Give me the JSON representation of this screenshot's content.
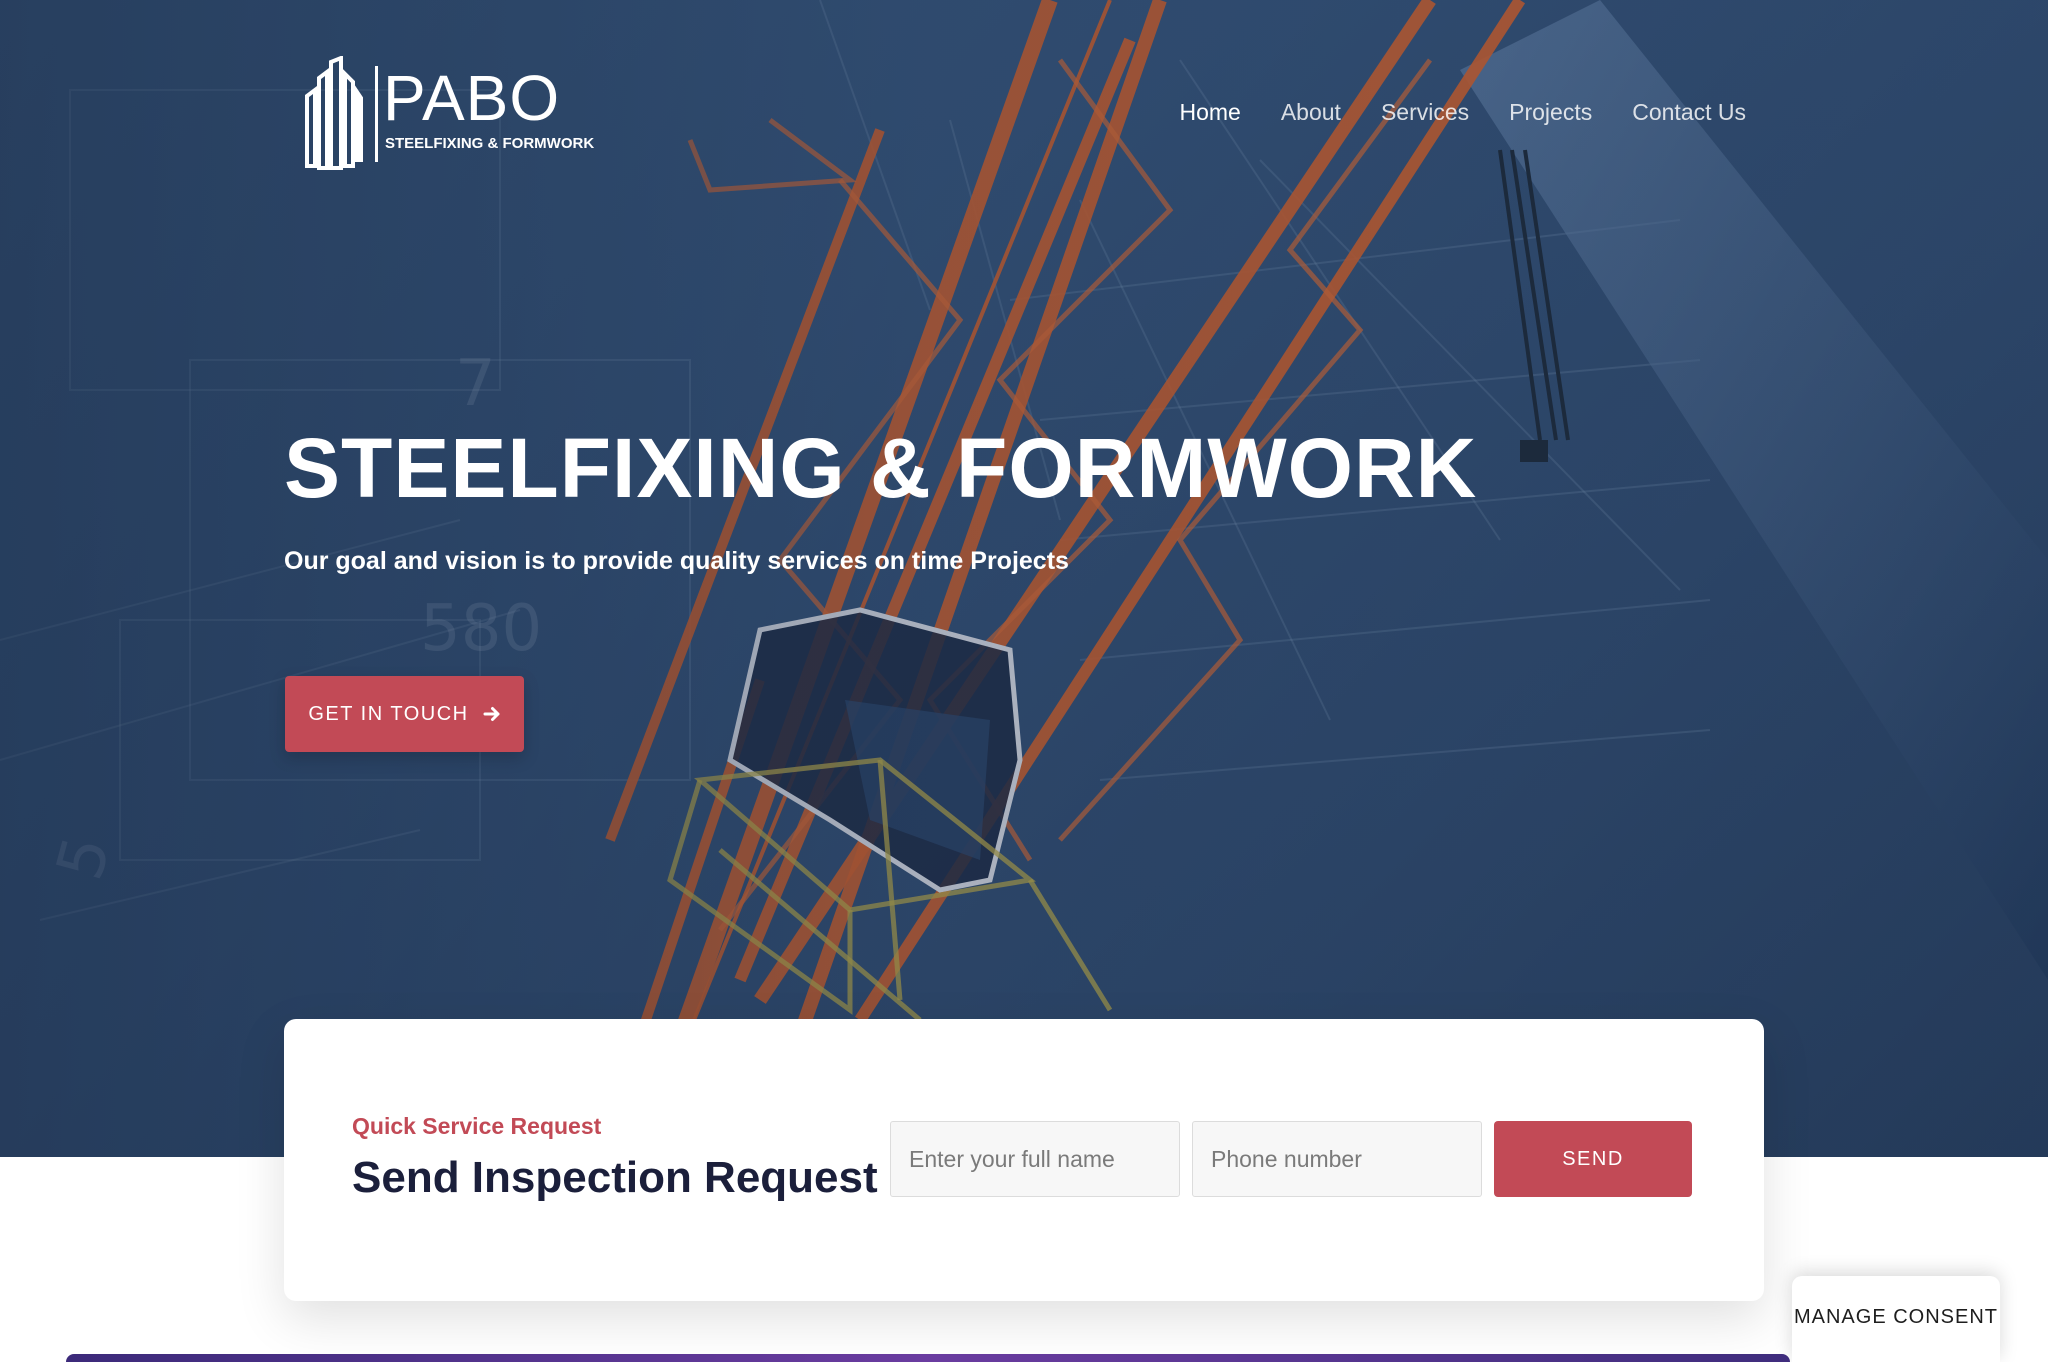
{
  "brand": {
    "name": "PABO",
    "tagline": "STEELFIXING & FORMWORK"
  },
  "nav": {
    "items": [
      {
        "label": "Home",
        "active": true
      },
      {
        "label": "About",
        "active": false
      },
      {
        "label": "Services",
        "active": false
      },
      {
        "label": "Projects",
        "active": false
      },
      {
        "label": "Contact Us",
        "active": false
      }
    ]
  },
  "hero": {
    "title": "STEELFIXING & FORMWORK",
    "subtitle": "Our goal and vision is to provide quality services on time Projects",
    "cta_label": "GET IN TOUCH",
    "cta_icon": "arrow-right-icon"
  },
  "request": {
    "eyebrow": "Quick Service Request",
    "title": "Send Inspection Request",
    "name_placeholder": "Enter your full name",
    "phone_placeholder": "Phone number",
    "send_label": "SEND"
  },
  "consent": {
    "label": "MANAGE CONSENT"
  },
  "colors": {
    "accent": "#c24a56",
    "heading": "#1b1f3b",
    "hero_overlay": "#36557c"
  }
}
